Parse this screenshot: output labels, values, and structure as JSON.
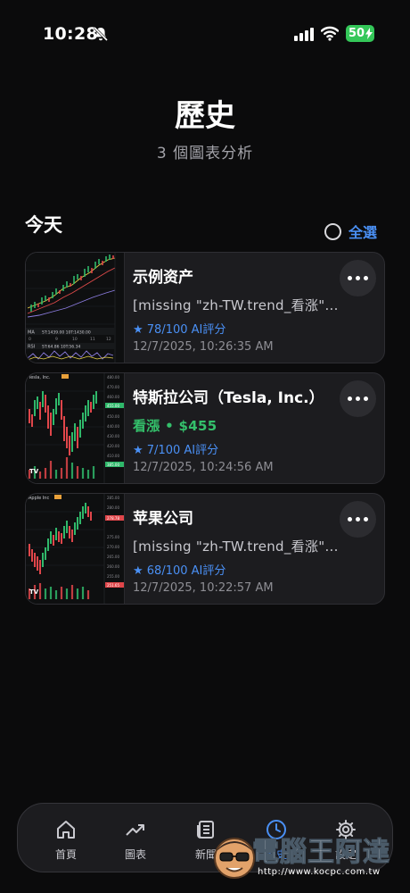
{
  "status_bar": {
    "time": "10:28",
    "battery": "50",
    "icons": [
      "bell-slash-icon",
      "cellular-signal-icon",
      "wifi-icon",
      "battery-charging-icon"
    ]
  },
  "header": {
    "title": "歷史",
    "subtitle": "3 個圖表分析"
  },
  "section": {
    "label": "今天",
    "select_all": "全選"
  },
  "cards": [
    {
      "title": "示例资产",
      "trend": "[missing \"zh-TW.trend_看涨\"...",
      "score": "★ 78/100 AI評分",
      "date": "12/7/2025, 10:26:35 AM",
      "thumb_text": {
        "ma_label": "MA",
        "ma_values": "ST:1439.00 10T:1430.00",
        "axis_a": "0",
        "axis_b": "9",
        "axis_c": "10",
        "axis_d": "11",
        "axis_e": "12",
        "rsi_label": "RSI",
        "rsi_values": "ST:64.86 10T:56.34"
      }
    },
    {
      "title": "特斯拉公司（Tesla, Inc.）",
      "trend": "看漲 • $455",
      "score": "★ 7/100 AI評分",
      "date": "12/7/2025, 10:24:56 AM",
      "thumb_text": {
        "name": "Tesla, Inc.",
        "prices": [
          "480.00",
          "470.00",
          "460.00",
          "450.00",
          "440.00",
          "430.00",
          "420.00",
          "410.00",
          "400.00",
          "390.00"
        ],
        "tag_high": "455.00",
        "tag_low": "385.00"
      }
    },
    {
      "title": "苹果公司",
      "trend": "[missing \"zh-TW.trend_看涨\"...",
      "score": "★ 68/100 AI評分",
      "date": "12/7/2025, 10:22:57 AM",
      "thumb_text": {
        "name": "Apple Inc",
        "prices": [
          "285.00",
          "280.00",
          "275.00",
          "270.00",
          "265.00",
          "260.00",
          "255.00",
          "250.00"
        ],
        "tag_high": "278.78",
        "tag_low": "251.65"
      }
    }
  ],
  "tabbar": {
    "items": [
      {
        "label": "首頁",
        "icon": "home-icon"
      },
      {
        "label": "圖表",
        "icon": "chart-trend-icon"
      },
      {
        "label": "新聞",
        "icon": "newspaper-icon"
      },
      {
        "label": "歷史",
        "icon": "clock-icon"
      },
      {
        "label": "設定",
        "icon": "gear-icon"
      }
    ],
    "active": "歷史"
  },
  "watermark": {
    "text": "電腦王阿達",
    "url": "http://www.kocpc.com.tw"
  },
  "colors": {
    "accent_blue": "#4a90f5",
    "bullish_green": "#34c06b",
    "candle_red": "#e0464a",
    "candle_green": "#2fb86a",
    "background": "#0b0b0c",
    "card": "#1c1c1f"
  }
}
